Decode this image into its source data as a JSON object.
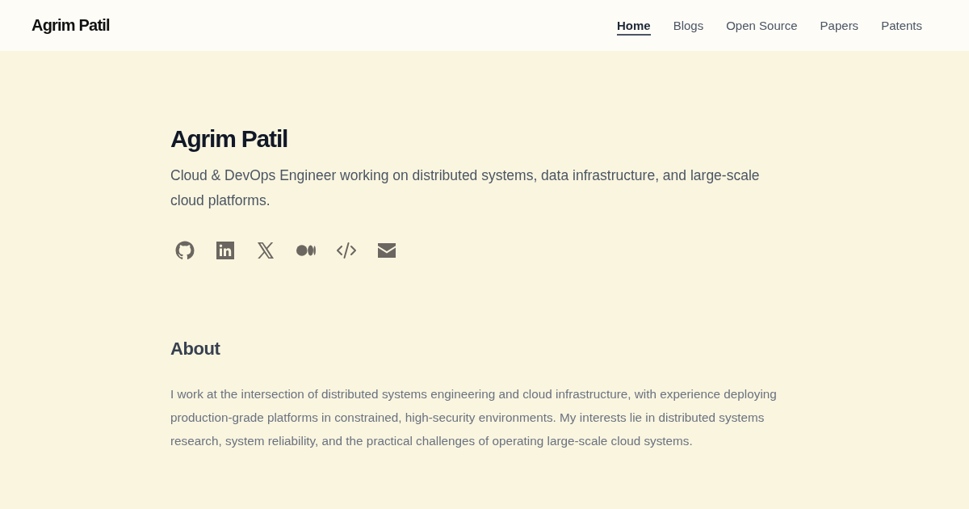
{
  "header": {
    "brand": "Agrim Patil",
    "nav": [
      {
        "label": "Home",
        "selected": true
      },
      {
        "label": "Blogs",
        "selected": false
      },
      {
        "label": "Open Source",
        "selected": false
      },
      {
        "label": "Papers",
        "selected": false
      },
      {
        "label": "Patents",
        "selected": false
      }
    ]
  },
  "hero": {
    "name": "Agrim Patil",
    "tagline": "Cloud & DevOps Engineer working on distributed systems, data infrastructure, and large-scale cloud platforms.",
    "social_links": [
      {
        "kind": "github"
      },
      {
        "kind": "linkedin"
      },
      {
        "kind": "x"
      },
      {
        "kind": "medium"
      },
      {
        "kind": "code"
      },
      {
        "kind": "email"
      }
    ]
  },
  "about": {
    "heading": "About",
    "body": "I work at the intersection of distributed systems engineering and cloud infrastructure, with experience deploying production-grade platforms in constrained, high-security environments. My interests lie in distributed systems research, system reliability, and the practical challenges of operating large-scale cloud systems."
  }
}
